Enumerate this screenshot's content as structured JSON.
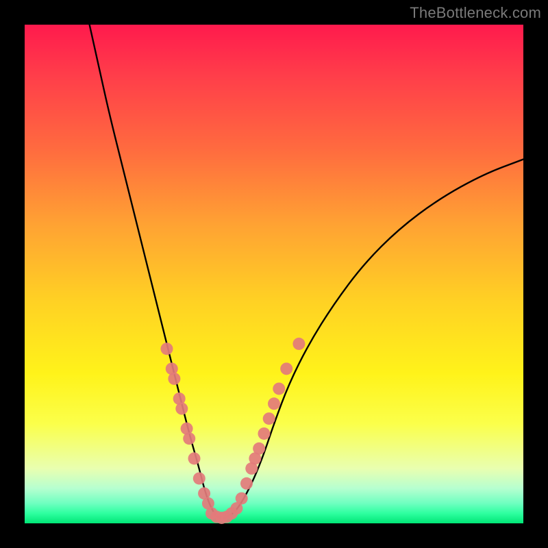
{
  "watermark": {
    "text": "TheBottleneck.com"
  },
  "chart_data": {
    "type": "line",
    "title": "",
    "xlabel": "",
    "ylabel": "",
    "xlim": [
      0,
      100
    ],
    "ylim": [
      0,
      100
    ],
    "series": [
      {
        "name": "bottleneck-curve",
        "x": [
          13,
          15,
          17,
          20,
          23,
          26,
          29,
          31,
          33,
          35,
          36,
          37,
          38,
          39,
          40,
          42,
          44,
          46,
          48,
          50,
          53,
          57,
          62,
          68,
          75,
          83,
          92,
          100
        ],
        "y": [
          100,
          91,
          82,
          70,
          58,
          46,
          34,
          26,
          18,
          11,
          7,
          4,
          2,
          1,
          1,
          2,
          5,
          9,
          14,
          20,
          28,
          36,
          44,
          52,
          59,
          65,
          70,
          73
        ]
      }
    ],
    "markers": [
      {
        "name": "left-dot-cluster",
        "color": "#e37b7b",
        "points": [
          {
            "x": 28.5,
            "y": 35
          },
          {
            "x": 29.5,
            "y": 31
          },
          {
            "x": 30.0,
            "y": 29
          },
          {
            "x": 31.0,
            "y": 25
          },
          {
            "x": 31.5,
            "y": 23
          },
          {
            "x": 32.5,
            "y": 19
          },
          {
            "x": 33.0,
            "y": 17
          },
          {
            "x": 34.0,
            "y": 13
          },
          {
            "x": 35.0,
            "y": 9
          },
          {
            "x": 36.0,
            "y": 6
          },
          {
            "x": 36.8,
            "y": 4
          }
        ]
      },
      {
        "name": "valley-dot-cluster",
        "color": "#e37b7b",
        "points": [
          {
            "x": 37.5,
            "y": 2
          },
          {
            "x": 38.5,
            "y": 1.3
          },
          {
            "x": 39.5,
            "y": 1.1
          },
          {
            "x": 40.5,
            "y": 1.3
          },
          {
            "x": 41.5,
            "y": 2
          }
        ]
      },
      {
        "name": "right-dot-cluster",
        "color": "#e37b7b",
        "points": [
          {
            "x": 42.5,
            "y": 3
          },
          {
            "x": 43.5,
            "y": 5
          },
          {
            "x": 44.5,
            "y": 8
          },
          {
            "x": 45.5,
            "y": 11
          },
          {
            "x": 46.2,
            "y": 13
          },
          {
            "x": 47.0,
            "y": 15
          },
          {
            "x": 48.0,
            "y": 18
          },
          {
            "x": 49.0,
            "y": 21
          },
          {
            "x": 50.0,
            "y": 24
          },
          {
            "x": 51.0,
            "y": 27
          },
          {
            "x": 52.5,
            "y": 31
          },
          {
            "x": 55.0,
            "y": 36
          }
        ]
      }
    ]
  }
}
